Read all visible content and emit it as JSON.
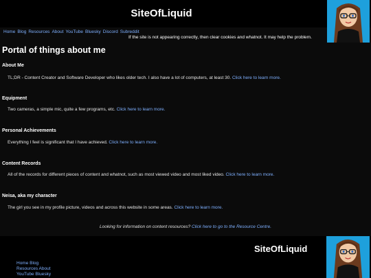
{
  "site": {
    "title": "SiteOfLiquid"
  },
  "nav": {
    "items": [
      "Home",
      "Blog",
      "Resources",
      "About",
      "YouTube",
      "Bluesky",
      "Discord",
      "Subreddit"
    ]
  },
  "notice": "If the site is not appearing correctly, then clear cookies and whatnot. It may help the problem.",
  "portal_title": "Portal of things about me",
  "sections": [
    {
      "title": "About Me",
      "text": "TL;DR - Content Creator and Software Developer who likes older tech. I also have a lot of computers, at least 30.",
      "link": "Click here to learn more."
    },
    {
      "title": "Equipment",
      "text": "Two cameras, a simple mic, quite a few programs, etc.",
      "link": "Click here to learn more."
    },
    {
      "title": "Personal Achievements",
      "text": "Everything I feel is significant that I have achieved.",
      "link": "Click here to learn more."
    },
    {
      "title": "Content Records",
      "text": "All of the records for different pieces of content and whatnot, such as most viewed video and most liked video.",
      "link": "Click here to learn more."
    },
    {
      "title": "Neisa, aka my character",
      "text": "The girl you see in my profile picture, videos and across this website in some areas.",
      "link": "Click here to learn more."
    }
  ],
  "resources": {
    "text": "Looking for information on content resources?",
    "link": "Click here to go to the Resource Centre."
  },
  "footer": {
    "title": "SiteOfLiquid",
    "links_row1": [
      "Home",
      "Blog"
    ],
    "links_row2": [
      "Resources",
      "About"
    ],
    "links_row3": [
      "YouTube",
      "Bluesky"
    ]
  },
  "colors": {
    "link": "#7fb0ff",
    "avatar_bg": "#1ea0dc"
  }
}
